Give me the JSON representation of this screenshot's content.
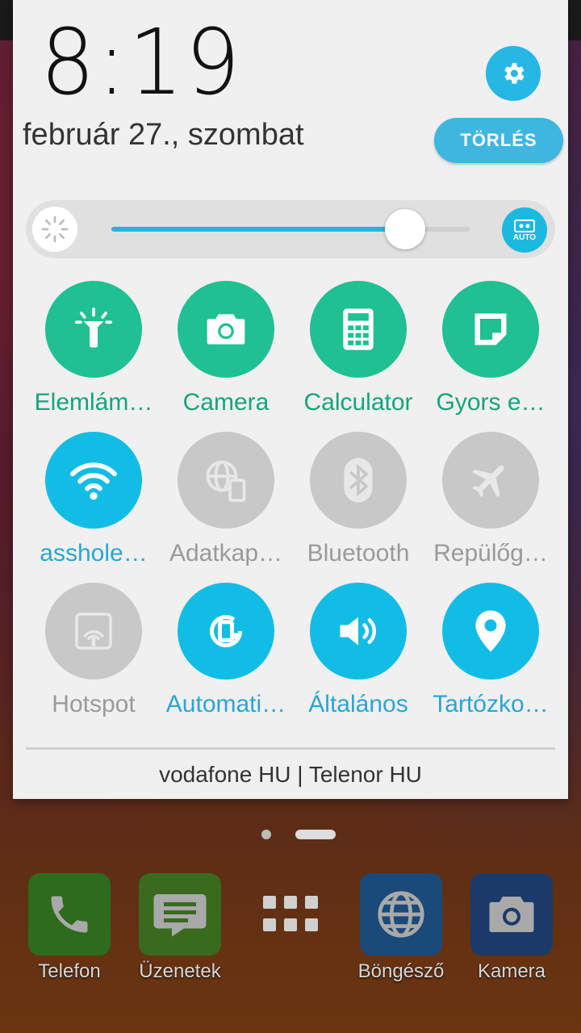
{
  "panel": {
    "time": "8:19",
    "date": "február 27., szombat",
    "clear_label": "TÖRLÉS",
    "brightness": {
      "level": 0.82,
      "auto_label": "AUTO"
    },
    "tiles": [
      {
        "label": "Elemlám…",
        "icon": "flashlight-icon",
        "state": "green"
      },
      {
        "label": "Camera",
        "icon": "camera-icon",
        "state": "green"
      },
      {
        "label": "Calculator",
        "icon": "calculator-icon",
        "state": "green"
      },
      {
        "label": "Gyors e…",
        "icon": "quick-memo-icon",
        "state": "green"
      },
      {
        "label": "asshole…",
        "icon": "wifi-icon",
        "state": "blue"
      },
      {
        "label": "Adatkap…",
        "icon": "mobile-data-icon",
        "state": "gray"
      },
      {
        "label": "Bluetooth",
        "icon": "bluetooth-icon",
        "state": "gray"
      },
      {
        "label": "Repülőg…",
        "icon": "airplane-icon",
        "state": "gray"
      },
      {
        "label": "Hotspot",
        "icon": "hotspot-icon",
        "state": "gray"
      },
      {
        "label": "Automati…",
        "icon": "auto-rotate-icon",
        "state": "blue"
      },
      {
        "label": "Általános",
        "icon": "volume-icon",
        "state": "blue"
      },
      {
        "label": "Tartózko…",
        "icon": "location-icon",
        "state": "blue"
      }
    ],
    "carrier": "vodafone HU | Telenor HU"
  },
  "dock": [
    {
      "label": "Telefon",
      "icon": "phone-icon"
    },
    {
      "label": "Üzenetek",
      "icon": "messages-icon"
    },
    {
      "label": "",
      "icon": "app-drawer-icon"
    },
    {
      "label": "Böngésző",
      "icon": "browser-icon"
    },
    {
      "label": "Kamera",
      "icon": "camera-icon"
    }
  ],
  "colors": {
    "green": "#1fc092",
    "blue": "#12bde5",
    "gray": "#c8c8c8",
    "accent": "#25b8e5"
  }
}
